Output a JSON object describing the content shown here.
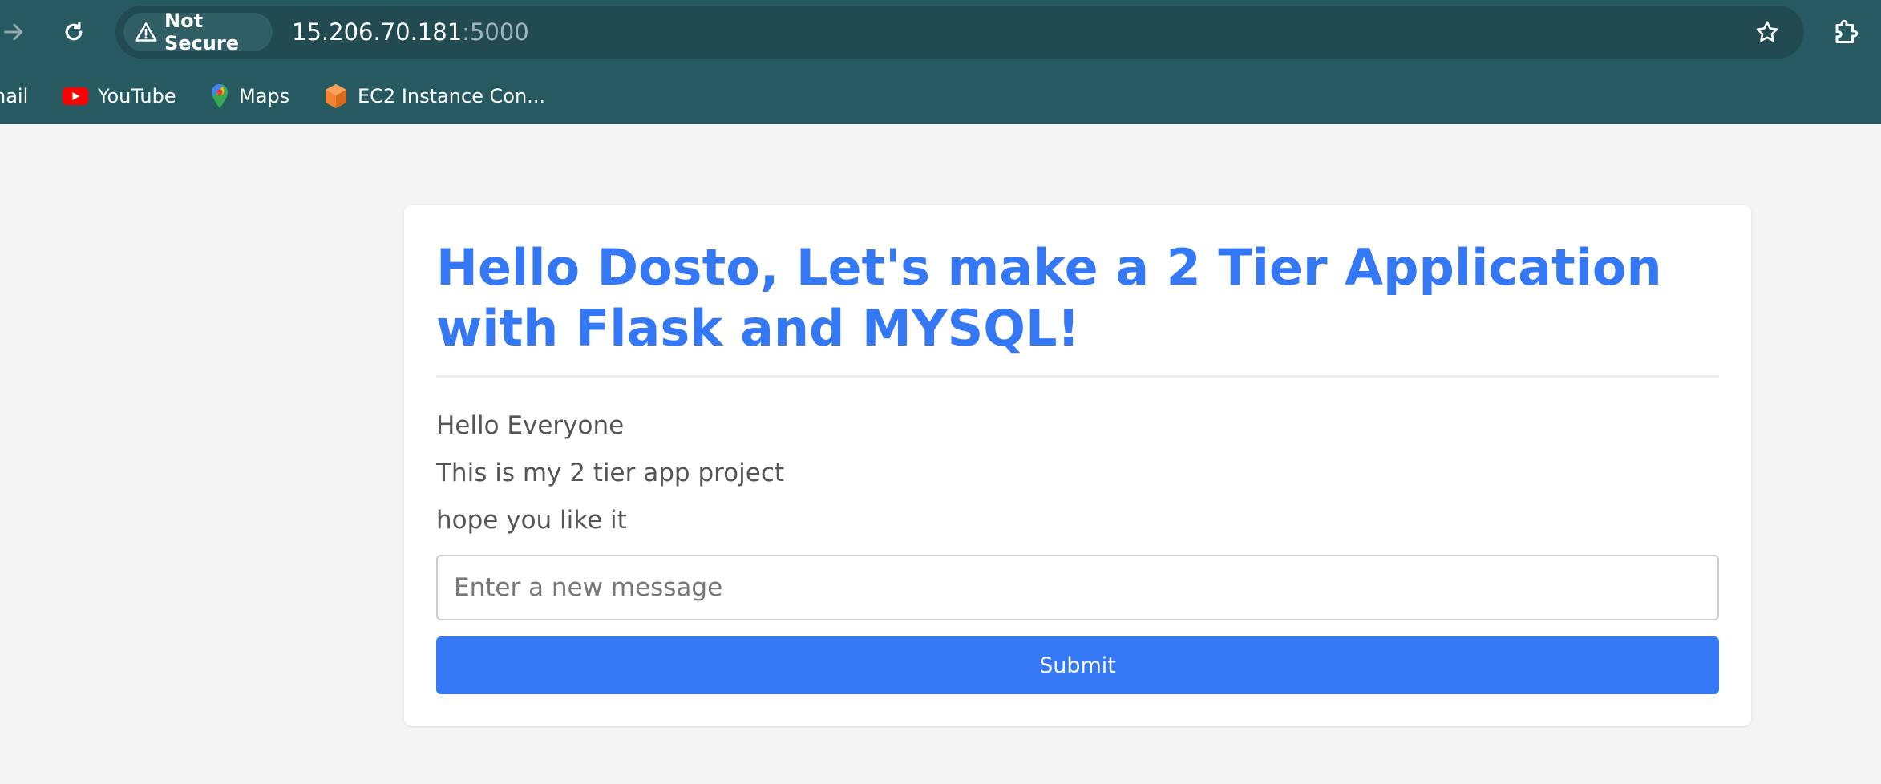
{
  "browser": {
    "security_label": "Not Secure",
    "url_host": "15.206.70.181",
    "url_port": ":5000",
    "bookmarks": [
      {
        "label": "nail",
        "icon": "gmail-icon"
      },
      {
        "label": "YouTube",
        "icon": "youtube-icon"
      },
      {
        "label": "Maps",
        "icon": "maps-icon"
      },
      {
        "label": "EC2 Instance Con...",
        "icon": "aws-box-icon"
      }
    ]
  },
  "page": {
    "title": "Hello Dosto, Let's make a 2 Tier Application with Flask and MYSQL!",
    "messages": [
      "Hello Everyone",
      "This is my 2 tier app project",
      "hope you like it"
    ],
    "input": {
      "placeholder": "Enter a new message",
      "value": ""
    },
    "submit_label": "Submit"
  },
  "colors": {
    "chrome": "#265a60",
    "omnibox": "#214a51",
    "accent": "#3478f6",
    "page_bg": "#f4f4f4"
  }
}
